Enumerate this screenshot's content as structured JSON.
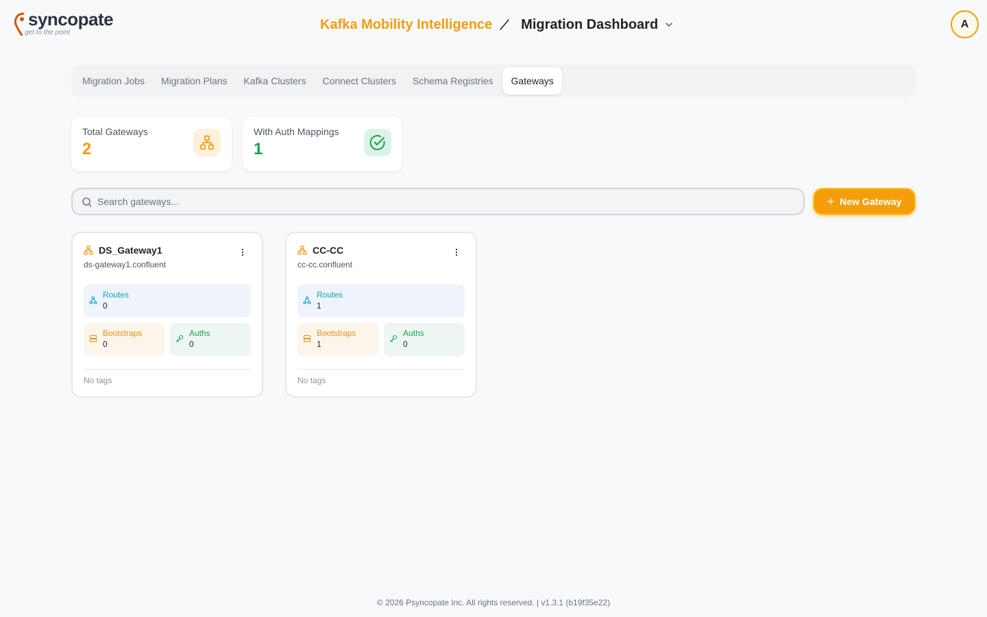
{
  "header": {
    "logo_word": "syncopate",
    "logo_tagline": "get to the point",
    "app_title": "Kafka Mobility Intelligence",
    "page_title": "Migration Dashboard",
    "avatar_initial": "A"
  },
  "tabs": [
    {
      "label": "Migration Jobs"
    },
    {
      "label": "Migration Plans"
    },
    {
      "label": "Kafka Clusters"
    },
    {
      "label": "Connect Clusters"
    },
    {
      "label": "Schema Registries"
    },
    {
      "label": "Gateways",
      "active": true
    }
  ],
  "stats": [
    {
      "label": "Total Gateways",
      "value": "2",
      "color": "#f39c12",
      "icon": "network-icon"
    },
    {
      "label": "With Auth Mappings",
      "value": "1",
      "color": "#16a34a",
      "icon": "check-circle-icon"
    }
  ],
  "search": {
    "placeholder": "Search gateways..."
  },
  "new_button": {
    "icon": "+",
    "label": "New Gateway"
  },
  "gateways": [
    {
      "name": "DS_Gateway1",
      "host": "ds-gateway1.confluent",
      "routes_label": "Routes",
      "routes": "0",
      "bootstraps_label": "Bootstraps",
      "bootstraps": "0",
      "auths_label": "Auths",
      "auths": "0",
      "tags": "No tags"
    },
    {
      "name": "CC-CC",
      "host": "cc-cc.confluent",
      "routes_label": "Routes",
      "routes": "1",
      "bootstraps_label": "Bootstraps",
      "bootstraps": "1",
      "auths_label": "Auths",
      "auths": "0",
      "tags": "No tags"
    }
  ],
  "footer": {
    "text": "© 2026 Psyncopate Inc. All rights reserved. | v1.3.1 (b19f35e22)"
  },
  "colors": {
    "accent": "#f39c12",
    "success": "#16a34a",
    "info": "#0ea5c6"
  }
}
